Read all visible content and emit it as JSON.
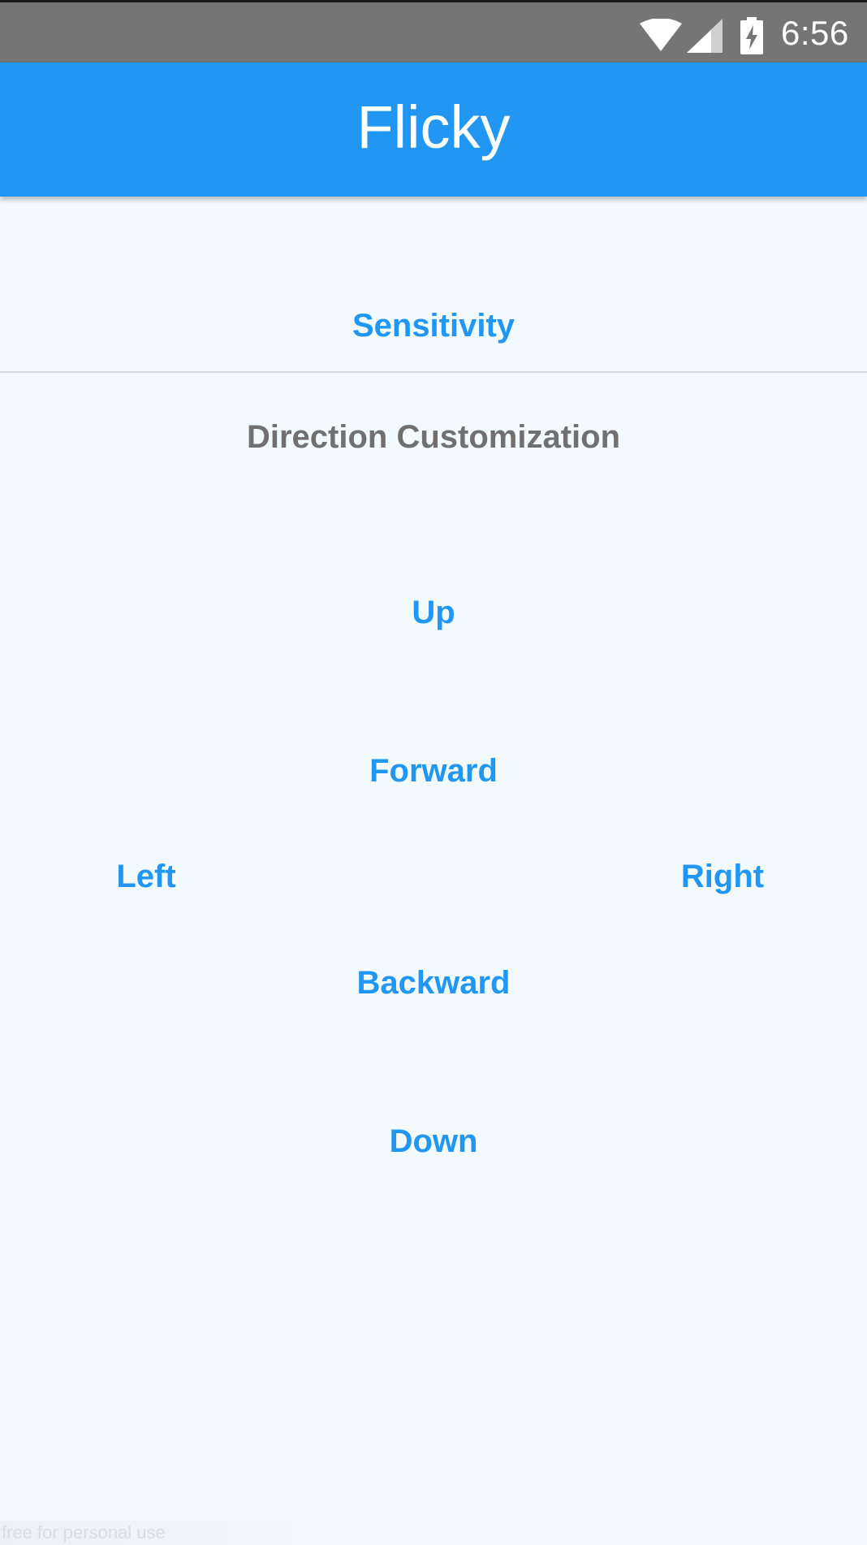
{
  "status_bar": {
    "time": "6:56",
    "icons": [
      "wifi-icon",
      "signal-icon",
      "battery-charging-icon"
    ],
    "color": "#757575"
  },
  "app_bar": {
    "title": "Flicky",
    "color": "#2196F3"
  },
  "settings": {
    "sensitivity_label": "Sensitivity"
  },
  "direction_customization": {
    "heading": "Direction Customization",
    "up": "Up",
    "forward": "Forward",
    "left": "Left",
    "right": "Right",
    "backward": "Backward",
    "down": "Down"
  },
  "watermark": {
    "text": "free for personal use"
  }
}
